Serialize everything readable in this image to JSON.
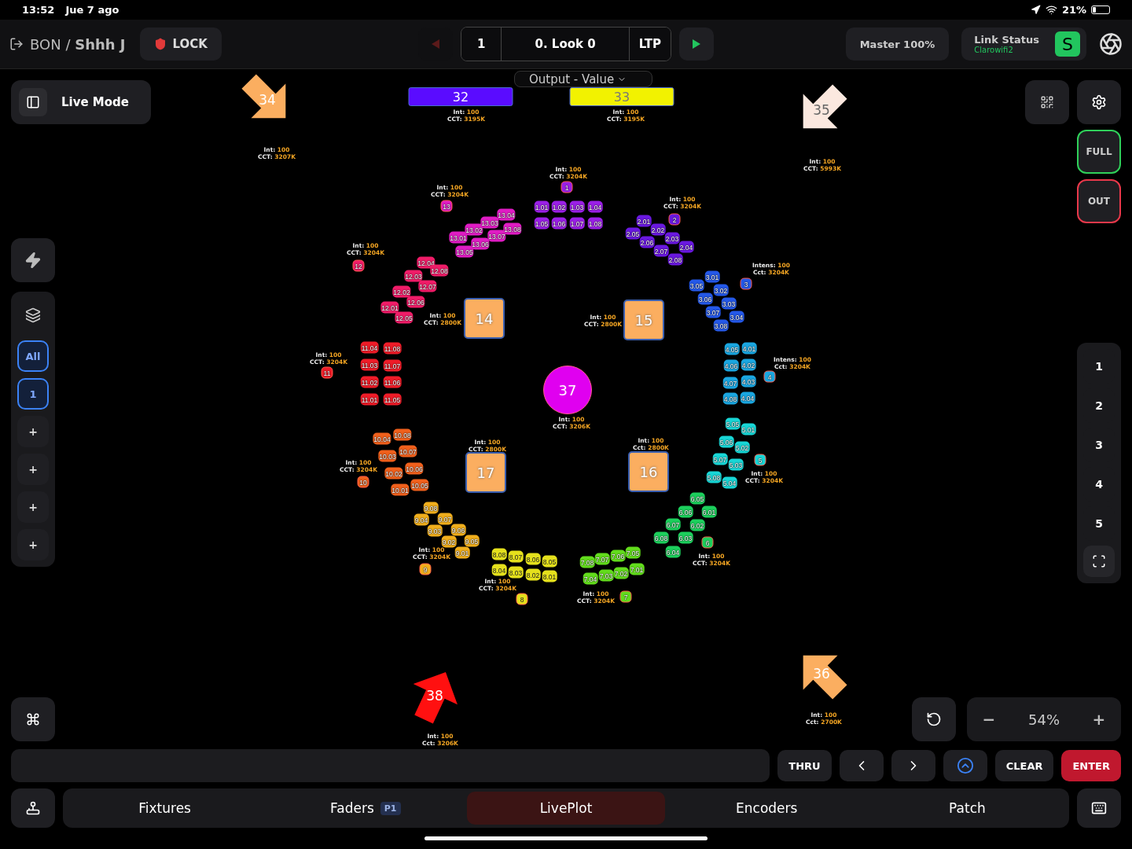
{
  "status_bar": {
    "time": "13:52",
    "date": "Jue 7 ago",
    "battery": "21%"
  },
  "top_bar": {
    "show": "BON / **Shhh J**",
    "lock": "LOCK",
    "cue_list": "1",
    "cue": "0. Look 0",
    "mode": "LTP",
    "prev_disabled": true,
    "master": "Master 100%",
    "link": {
      "title": "Link Status",
      "network": "Clarowifi2",
      "badge": "S"
    }
  },
  "live_mode": "Live Mode",
  "layers": [
    {
      "label": "All",
      "selected": true
    },
    {
      "label": "1",
      "selected": true
    },
    {
      "label": "+",
      "selected": false
    },
    {
      "label": "+",
      "selected": false
    },
    {
      "label": "+",
      "selected": false
    },
    {
      "label": "+",
      "selected": false
    }
  ],
  "output_menu": "Output - Value",
  "side_buttons": [
    {
      "label": "FULL",
      "color": "#2fd05a"
    },
    {
      "label": "OUT",
      "color": "#e8384a"
    }
  ],
  "presets": [
    "1",
    "2",
    "3",
    "4",
    "5"
  ],
  "zoom": {
    "minus": "−",
    "value": "54%",
    "plus": "+"
  },
  "fixtures": [
    {
      "number": "34",
      "kind": "arrow",
      "color": "#fbae60",
      "readout": [
        {
          "key": "Int:",
          "value": "100"
        },
        {
          "key": "CCT:",
          "value": "3207K"
        }
      ]
    },
    {
      "number": "32",
      "kind": "bar",
      "color": "#5a0cff",
      "readout": [
        {
          "key": "Int:",
          "value": "100"
        },
        {
          "key": "CCT:",
          "value": "3195K"
        }
      ]
    },
    {
      "number": "33",
      "kind": "bar",
      "color": "#f2f200",
      "readout": [
        {
          "key": "Int:",
          "value": "100"
        },
        {
          "key": "CCT:",
          "value": "3195K"
        }
      ]
    },
    {
      "number": "35",
      "kind": "arrow",
      "color": "#fbe8df",
      "readout": [
        {
          "key": "Int:",
          "value": "100"
        },
        {
          "key": "CCT:",
          "value": "5993K"
        }
      ]
    },
    {
      "number": "14",
      "kind": "square",
      "color": "#fbae60",
      "readout": [
        {
          "key": "Int:",
          "value": "100"
        },
        {
          "key": "CCT:",
          "value": "2800K"
        }
      ]
    },
    {
      "number": "15",
      "kind": "square",
      "color": "#fbae60",
      "readout": [
        {
          "key": "Int:",
          "value": "100"
        },
        {
          "key": "CCT:",
          "value": "2800K"
        }
      ]
    },
    {
      "number": "37",
      "kind": "circle",
      "color": "#e000f0",
      "readout": [
        {
          "key": "Int:",
          "value": "100"
        },
        {
          "key": "CCT:",
          "value": "3206K"
        }
      ]
    },
    {
      "number": "17",
      "kind": "square",
      "color": "#fbae60",
      "readout": [
        {
          "key": "Int:",
          "value": "100"
        },
        {
          "key": "CCT:",
          "value": "2800K"
        }
      ]
    },
    {
      "number": "16",
      "kind": "square",
      "color": "#fbae60",
      "readout": [
        {
          "key": "Int:",
          "value": "100"
        },
        {
          "key": "Cct:",
          "value": "2800K"
        }
      ]
    },
    {
      "number": "38",
      "kind": "arrow",
      "color": "#ff1010",
      "readout": [
        {
          "key": "Int:",
          "value": "100"
        },
        {
          "key": "Cct:",
          "value": "3206K"
        }
      ]
    },
    {
      "number": "36",
      "kind": "arrow",
      "color": "#fbae60",
      "readout": [
        {
          "key": "Int:",
          "value": "100"
        },
        {
          "key": "Cct:",
          "value": "2700K"
        }
      ]
    }
  ],
  "groups": [
    {
      "number": "13",
      "color": "#e01cc4",
      "readout": [
        {
          "key": "Int:",
          "value": "100"
        },
        {
          "key": "CCT:",
          "value": "3204K"
        }
      ],
      "cells": [
        "13.01",
        "13.02",
        "13.03",
        "13.04",
        "13.05",
        "13.06",
        "13.07",
        "13.08"
      ]
    },
    {
      "number": "1",
      "color": "#9a1fe6",
      "readout": [
        {
          "key": "Int:",
          "value": "100"
        },
        {
          "key": "CCT:",
          "value": "3204K"
        }
      ],
      "cells": [
        "1.01",
        "1.02",
        "1.03",
        "1.04",
        "1.05",
        "1.06",
        "1.07",
        "1.08"
      ]
    },
    {
      "number": "2",
      "color": "#6a18e0",
      "readout": [
        {
          "key": "Int:",
          "value": "100"
        },
        {
          "key": "CCT:",
          "value": "3204K"
        }
      ],
      "cells": [
        "2.01",
        "2.02",
        "2.03",
        "2.04",
        "2.05",
        "2.06",
        "2.07",
        "2.08"
      ]
    },
    {
      "number": "12",
      "color": "#f01c68",
      "readout": [
        {
          "key": "Int:",
          "value": "100"
        },
        {
          "key": "CCT:",
          "value": "3204K"
        }
      ],
      "cells": [
        "12.01",
        "12.02",
        "12.03",
        "12.04",
        "12.05",
        "12.06",
        "12.07",
        "12.08"
      ]
    },
    {
      "number": "3",
      "color": "#2458e8",
      "readout": [
        {
          "key": "Intens:",
          "value": "100"
        },
        {
          "key": "Cct:",
          "value": "3204K"
        }
      ],
      "cells": [
        "3.01",
        "3.02",
        "3.03",
        "3.04",
        "3.05",
        "3.06",
        "3.07",
        "3.08"
      ]
    },
    {
      "number": "11",
      "color": "#ee1c28",
      "readout": [
        {
          "key": "Int:",
          "value": "100"
        },
        {
          "key": "CCT:",
          "value": "3204K"
        }
      ],
      "cells": [
        "11.04",
        "11.08",
        "11.03",
        "11.07",
        "11.02",
        "11.06",
        "11.01",
        "11.05"
      ]
    },
    {
      "number": "4",
      "color": "#1aa6e0",
      "readout": [
        {
          "key": "Intens:",
          "value": "100"
        },
        {
          "key": "Cct:",
          "value": "3204K"
        }
      ],
      "cells": [
        "4.05",
        "4.01",
        "4.06",
        "4.02",
        "4.07",
        "4.03",
        "4.08",
        "4.04"
      ]
    },
    {
      "number": "10",
      "color": "#f0601c",
      "readout": [
        {
          "key": "Int:",
          "value": "100"
        },
        {
          "key": "CCT:",
          "value": "3204K"
        }
      ],
      "cells": [
        "10.01",
        "10.02",
        "10.03",
        "10.04",
        "10.05",
        "10.06",
        "10.07",
        "10.08"
      ]
    },
    {
      "number": "5",
      "color": "#18d6d6",
      "readout": [
        {
          "key": "Int:",
          "value": "100"
        },
        {
          "key": "CCT:",
          "value": "3204K"
        }
      ],
      "cells": [
        "5.05",
        "5.01",
        "5.06",
        "5.02",
        "5.07",
        "5.03",
        "5.08",
        "5.04"
      ]
    },
    {
      "number": "9",
      "color": "#f0ae1c",
      "readout": [
        {
          "key": "Int:",
          "value": "100"
        },
        {
          "key": "CCT:",
          "value": "3204K"
        }
      ],
      "cells": [
        "9.01",
        "9.02",
        "9.03",
        "9.04",
        "9.05",
        "9.06",
        "9.07",
        "9.08"
      ]
    },
    {
      "number": "6",
      "color": "#1ccf5c",
      "readout": [
        {
          "key": "Int:",
          "value": "100"
        },
        {
          "key": "CCT:",
          "value": "3204K"
        }
      ],
      "cells": [
        "6.01",
        "6.02",
        "6.03",
        "6.04",
        "6.05",
        "6.06",
        "6.07",
        "6.08"
      ]
    },
    {
      "number": "8",
      "color": "#e4e01c",
      "readout": [
        {
          "key": "Int:",
          "value": "100"
        },
        {
          "key": "CCT:",
          "value": "3204K"
        }
      ],
      "cells": [
        "8.08",
        "8.07",
        "8.06",
        "8.05",
        "8.04",
        "8.03",
        "8.02",
        "8.01"
      ]
    },
    {
      "number": "7",
      "color": "#62dc1c",
      "readout": [
        {
          "key": "Int:",
          "value": "100"
        },
        {
          "key": "CCT:",
          "value": "3204K"
        }
      ],
      "cells": [
        "7.08",
        "7.07",
        "7.06",
        "7.05",
        "7.04",
        "7.03",
        "7.02",
        "7.01"
      ]
    }
  ],
  "command_buttons": [
    {
      "label": "THRU",
      "kind": "plain"
    },
    {
      "kind": "prev"
    },
    {
      "kind": "next"
    },
    {
      "kind": "up"
    },
    {
      "label": "CLEAR",
      "kind": "plain"
    },
    {
      "label": "ENTER",
      "kind": "accent"
    }
  ],
  "tabs": [
    {
      "label": "Fixtures",
      "selected": false
    },
    {
      "label": "Faders",
      "badge": "P1",
      "selected": false
    },
    {
      "label": "LivePlot",
      "selected": true
    },
    {
      "label": "Encoders",
      "selected": false
    },
    {
      "label": "Patch",
      "selected": false
    }
  ]
}
